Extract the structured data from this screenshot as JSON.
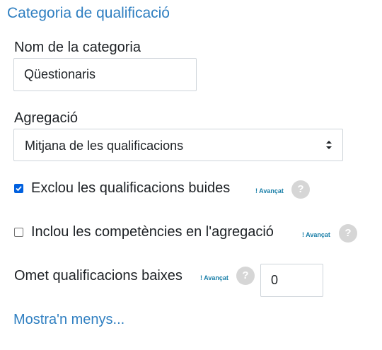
{
  "section": {
    "title": "Categoria de qualificació"
  },
  "category_name": {
    "label": "Nom de la categoria",
    "value": "Qüestionaris"
  },
  "aggregation": {
    "label": "Agregació",
    "selected": "Mitjana de les qualificacions"
  },
  "exclude_empty": {
    "label": "Exclou les qualificacions buides",
    "checked": true,
    "advanced_tag": "! Avançat",
    "help": "?"
  },
  "include_outcomes": {
    "label": "Inclou les competències en l'agregació",
    "checked": false,
    "advanced_tag": "! Avançat",
    "help": "?"
  },
  "drop_lowest": {
    "label": "Omet qualificacions baixes",
    "advanced_tag": "! Avançat",
    "help": "?",
    "value": "0"
  },
  "show_less_link": "Mostra'n menys..."
}
